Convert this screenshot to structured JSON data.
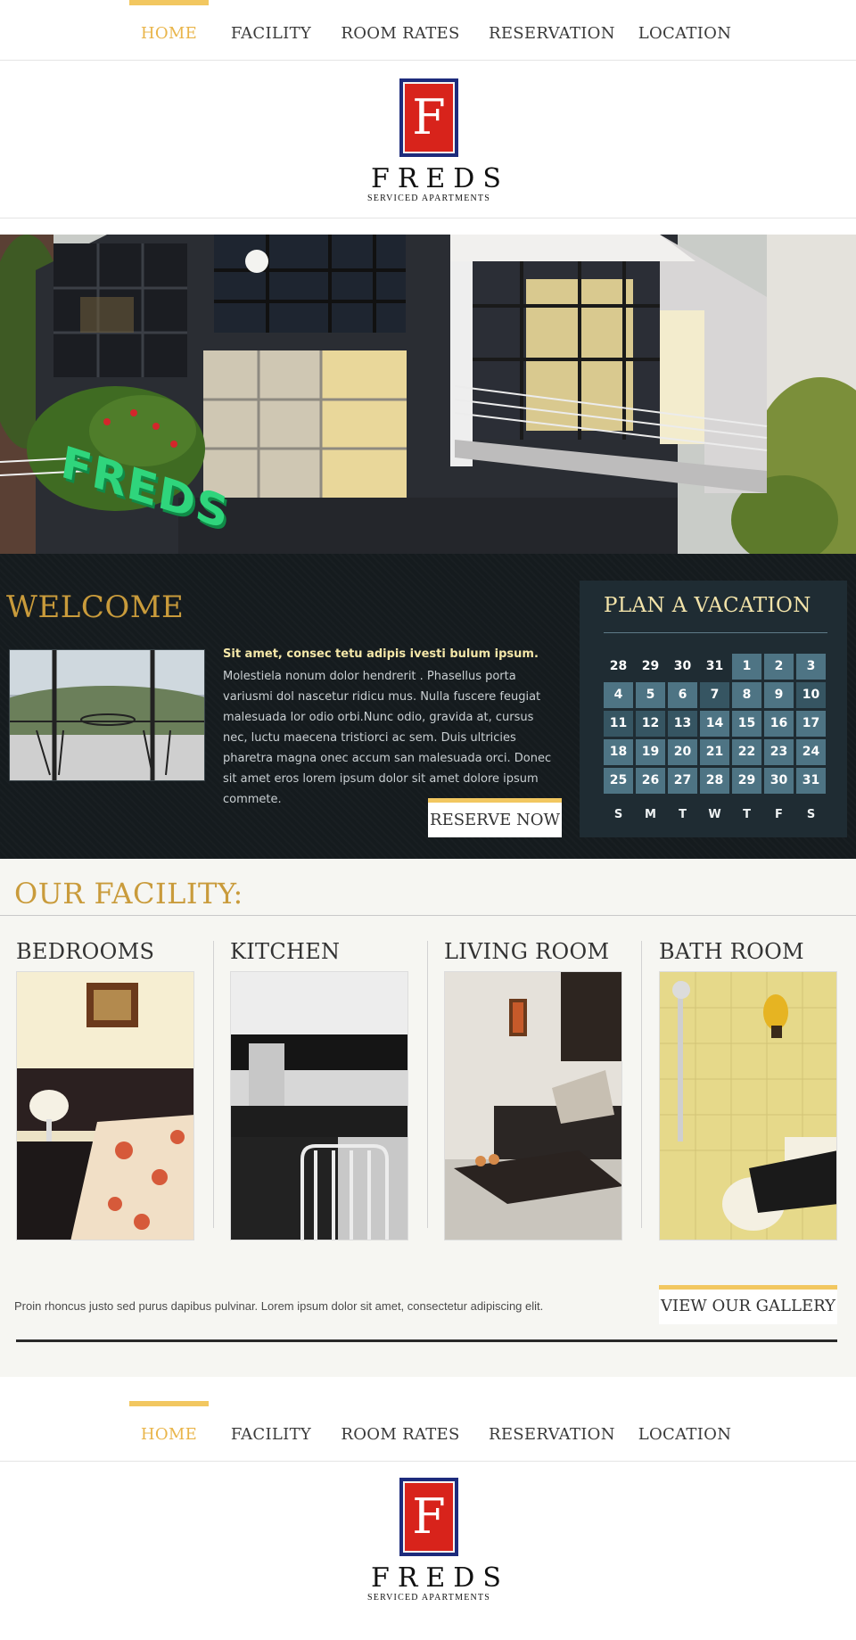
{
  "nav": {
    "items": [
      {
        "label": "HOME",
        "active": true
      },
      {
        "label": "FACILITY",
        "active": false
      },
      {
        "label": "ROOM RATES",
        "active": false
      },
      {
        "label": "RESERVATION",
        "active": false
      },
      {
        "label": "LOCATION",
        "active": false
      }
    ]
  },
  "logo": {
    "letter": "F",
    "name": "FREDS",
    "tagline": "SERVICED APARTMENTS"
  },
  "hero": {
    "sign_text": "FREDS"
  },
  "welcome": {
    "title": "WELCOME",
    "lead": "Sit amet, consec tetu adipis ivesti bulum ipsum.",
    "body": "Molestiela nonum dolor hendrerit . Phasellus porta variusmi dol nascetur ridicu mus. Nulla fuscere feugiat malesuada lor odio orbi.Nunc odio, gravida at, cursus nec, luctu maecena tristiorci ac sem. Duis ultricies pharetra magna onec accum san malesuada orci. Donec sit amet eros lorem ipsum dolor sit amet dolore ipsum commete.",
    "reserve_label": "RESERVE NOW"
  },
  "plan": {
    "title": "PLAN A VACATION",
    "weeks": [
      [
        "28",
        "29",
        "30",
        "31",
        "1",
        "2",
        "3"
      ],
      [
        "4",
        "5",
        "6",
        "7",
        "8",
        "9",
        "10"
      ],
      [
        "11",
        "12",
        "13",
        "14",
        "15",
        "16",
        "17"
      ],
      [
        "18",
        "19",
        "20",
        "21",
        "22",
        "23",
        "24"
      ],
      [
        "25",
        "26",
        "27",
        "28",
        "29",
        "30",
        "31"
      ]
    ],
    "days": [
      "S",
      "M",
      "T",
      "W",
      "T",
      "F",
      "S"
    ],
    "colors": {
      "cell": "#4e7484",
      "cell_dark": "#365562"
    }
  },
  "facility": {
    "title": "OUR FACILITY:",
    "columns": [
      {
        "title": "BEDROOMS"
      },
      {
        "title": "KITCHEN"
      },
      {
        "title": "LIVING ROOM"
      },
      {
        "title": "BATH ROOM"
      }
    ],
    "note": "Proin rhoncus justo sed purus dapibus pulvinar. Lorem ipsum dolor sit amet, consectetur adipiscing elit.",
    "gallery_label": "VIEW OUR GALLERY"
  },
  "colors": {
    "accent": "#f2c760",
    "gold_text": "#c99b3b",
    "dark_band": "#151b1e",
    "logo_red": "#d8231b",
    "logo_navy": "#1d2b7c"
  }
}
